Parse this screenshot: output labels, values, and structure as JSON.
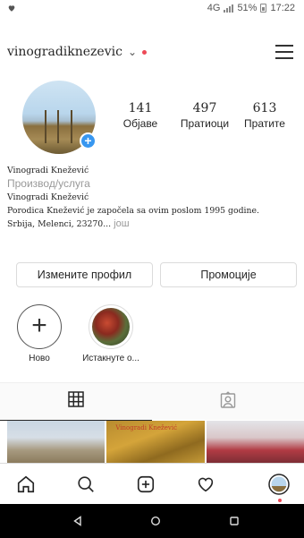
{
  "status_bar": {
    "left_icon": "heart-icon",
    "network": "4G",
    "battery": "51%",
    "time": "17:22"
  },
  "header": {
    "username": "vinogradiknezevic",
    "menu_icon": "hamburger-menu-icon"
  },
  "profile": {
    "stats": [
      {
        "key": "posts",
        "value": "141",
        "label": "Објаве"
      },
      {
        "key": "followers",
        "value": "497",
        "label": "Пратиоци"
      },
      {
        "key": "following",
        "value": "613",
        "label": "Пратите"
      }
    ],
    "bio": {
      "name": "Vinogradi Knežević",
      "category": "Производ/услуга",
      "line1": "Vinogradi Knežević",
      "line2": "Porodica Knežević je započela sa ovim poslom 1995 godine.",
      "line3": "Srbija, Melenci, 23270...",
      "more": " још"
    }
  },
  "actions": {
    "edit_profile": "Измените профил",
    "promotions": "Промоције"
  },
  "highlights": [
    {
      "label": "Ново"
    },
    {
      "label": "Истакнуте о..."
    }
  ],
  "grid_posts": {
    "post2_caption": "Vinogradi Knežević"
  },
  "colors": {
    "accent_blue": "#3897f0",
    "notification_red": "#ed4956",
    "border": "#dbdbdb"
  }
}
